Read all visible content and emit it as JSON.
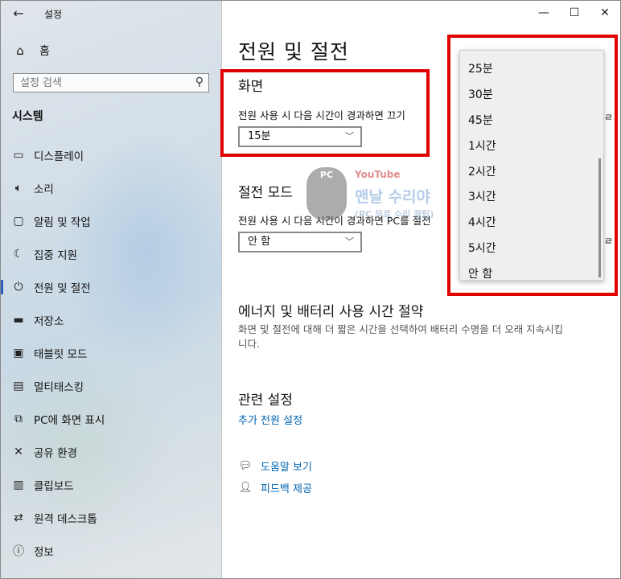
{
  "app_title": "설정",
  "sidebar": {
    "home_label": "홈",
    "search_placeholder": "설정 검색",
    "section_title": "시스템",
    "items": [
      {
        "label": "디스플레이",
        "icon": "monitor-icon"
      },
      {
        "label": "소리",
        "icon": "speaker-icon"
      },
      {
        "label": "알림 및 작업",
        "icon": "notification-icon"
      },
      {
        "label": "집중 지원",
        "icon": "moon-icon"
      },
      {
        "label": "전원 및 절전",
        "icon": "power-icon",
        "active": true
      },
      {
        "label": "저장소",
        "icon": "storage-icon"
      },
      {
        "label": "태블릿 모드",
        "icon": "tablet-icon"
      },
      {
        "label": "멀티태스킹",
        "icon": "multitasking-icon"
      },
      {
        "label": "PC에 화면 표시",
        "icon": "project-icon"
      },
      {
        "label": "공유 환경",
        "icon": "share-icon"
      },
      {
        "label": "클립보드",
        "icon": "clipboard-icon"
      },
      {
        "label": "원격 데스크톱",
        "icon": "remote-desktop-icon"
      },
      {
        "label": "정보",
        "icon": "info-icon"
      }
    ]
  },
  "main": {
    "page_title": "전원 및 절전",
    "screen": {
      "heading": "화면",
      "desc": "전원 사용 시 다음 시간이 경과하면 끄기",
      "selected": "15분"
    },
    "sleep": {
      "heading": "절전 모드",
      "desc": "전원 사용 시 다음 시간이 경과하면 PC를 절전",
      "selected": "안 함"
    },
    "energy": {
      "heading": "에너지 및 배터리 사용 시간 절약",
      "line1": "화면 및 절전에 대해 더 짧은 시간을 선택하여 배터리 수명을 더 오래 지속시킵",
      "line2": "니다."
    },
    "related": {
      "heading": "관련 설정",
      "link": "추가 전원 설정"
    },
    "help": {
      "help_link": "도움말 보기",
      "feedback_link": "피드백 제공"
    },
    "clipped_char": "ㄹ"
  },
  "dropdown": {
    "options": [
      "25분",
      "30분",
      "45분",
      "1시간",
      "2시간",
      "3시간",
      "4시간",
      "5시간",
      "안 함"
    ]
  },
  "watermark": {
    "badge": "PC",
    "youtube": "YouTube",
    "main": "맨날 수리야",
    "sub": "(PC 무료 수리 꿀팁)"
  },
  "colors": {
    "accent": "#0063b1",
    "highlight": "#e10000",
    "active_indicator": "#2a5fb8"
  }
}
